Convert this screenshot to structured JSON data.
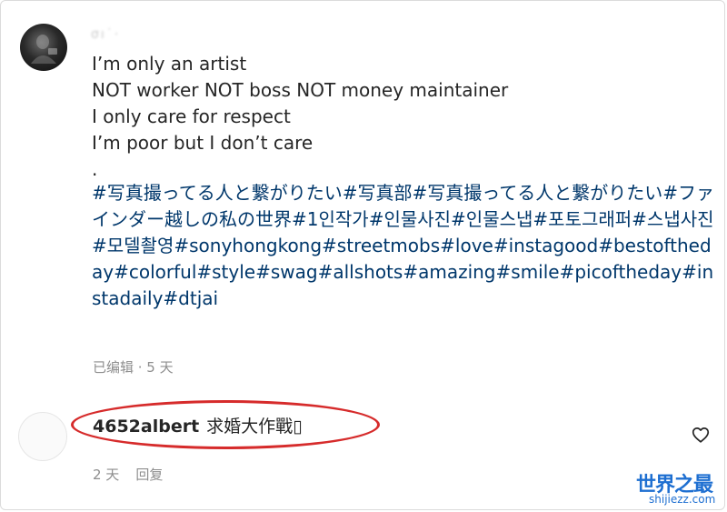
{
  "comment": {
    "username": "σı˙·",
    "lines": [
      "I’m only an artist",
      "NOT worker NOT boss NOT money maintainer",
      "I only care for respect",
      "I’m poor but I don’t care",
      "."
    ],
    "hashtags": [
      "#写真撮ってる人と繋がりたい",
      "#写真部",
      "#写真撮ってる人と繋がりたい",
      "#ファインダー越しの私の世界",
      "#1인작가",
      "#인물사진",
      "#인물스냅",
      "#포토그래퍼",
      "#스냅사진",
      "#모델촬영",
      "#sonyhongkong",
      "#streetmobs",
      "#love",
      "#instagood",
      "#bestoftheday",
      "#colorful",
      "#style",
      "#swag",
      "#allshots",
      "#amazing",
      "#smile",
      "#picoftheday",
      "#instadaily",
      "#dtjai"
    ],
    "meta": "已编辑 · 5 天"
  },
  "reply": {
    "username": "4652albert",
    "text": "求婚大作戰▯",
    "time": "2 天",
    "reply_label": "回复",
    "like_icon": "heart-outline-icon"
  },
  "watermark": {
    "title": "世界之最",
    "url": "shijiezz.com"
  },
  "colors": {
    "text": "#262626",
    "hashtag": "#00376b",
    "muted": "#8e8e8e",
    "highlight": "#d62b2b",
    "watermark": "#1e6fd1"
  }
}
